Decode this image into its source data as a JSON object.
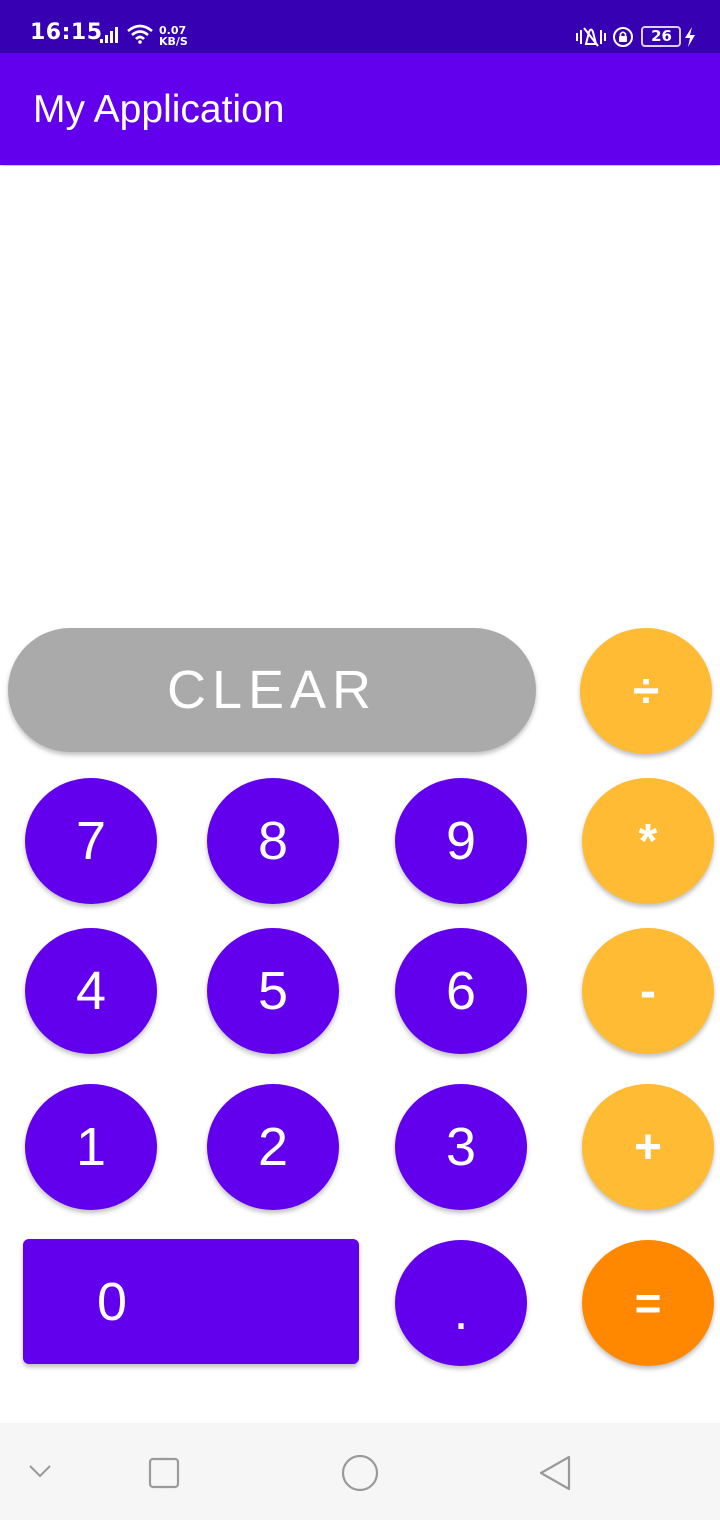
{
  "status_bar": {
    "time": "16:15",
    "net_speed_value": "0.07",
    "net_speed_unit": "KB/S",
    "battery_level": "26",
    "icons": [
      "signal-icon",
      "wifi-icon",
      "vibrate-icon",
      "rotation-lock-icon",
      "battery-icon",
      "charging-icon"
    ]
  },
  "app_bar": {
    "title": "My Application"
  },
  "display": {
    "value": ""
  },
  "keypad": {
    "clear": "CLEAR",
    "divide": "÷",
    "multiply": "*",
    "subtract": "-",
    "add": "+",
    "equals": "=",
    "d7": "7",
    "d8": "8",
    "d9": "9",
    "d4": "4",
    "d5": "5",
    "d6": "6",
    "d1": "1",
    "d2": "2",
    "d3": "3",
    "d0": "0",
    "dot": "."
  },
  "nav_bar": {
    "icons": [
      "hide-keyboard-icon",
      "recents-icon",
      "home-icon",
      "back-icon"
    ]
  },
  "colors": {
    "status_bar": "#3700B3",
    "primary": "#6200EE",
    "operator": "#FFBB33",
    "equals": "#FF8800",
    "clear": "#AAAAAA",
    "nav_bar": "#F6F6F6"
  }
}
